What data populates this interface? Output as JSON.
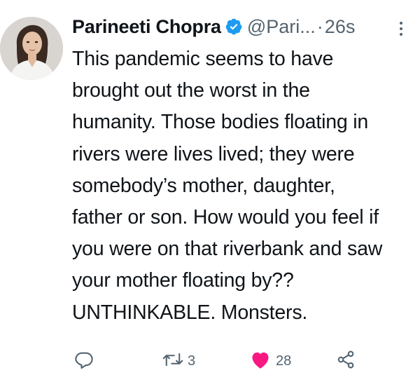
{
  "tweet": {
    "display_name": "Parineeti Chopra",
    "handle": "@Pari...",
    "separator": "·",
    "time": "26s",
    "body_lines": [
      "This pandemic seems to have",
      "brought out the worst in the",
      "humanity. Those bodies floating in",
      "rivers were lives lived; they were",
      "somebody’s mother, daughter,",
      "father or son. How would you feel if",
      "you were on that riverbank and saw",
      "your mother floating by??",
      "UNTHINKABLE. Monsters."
    ]
  },
  "actions": {
    "reply_icon": "reply-icon",
    "retweet_icon": "retweet-icon",
    "retweet_count": "3",
    "like_icon": "heart-icon",
    "like_count": "28",
    "share_icon": "share-icon"
  },
  "colors": {
    "verified": "#1d9bf0",
    "like": "#f91880",
    "secondary_text": "#536471",
    "primary_text": "#0f1419"
  }
}
